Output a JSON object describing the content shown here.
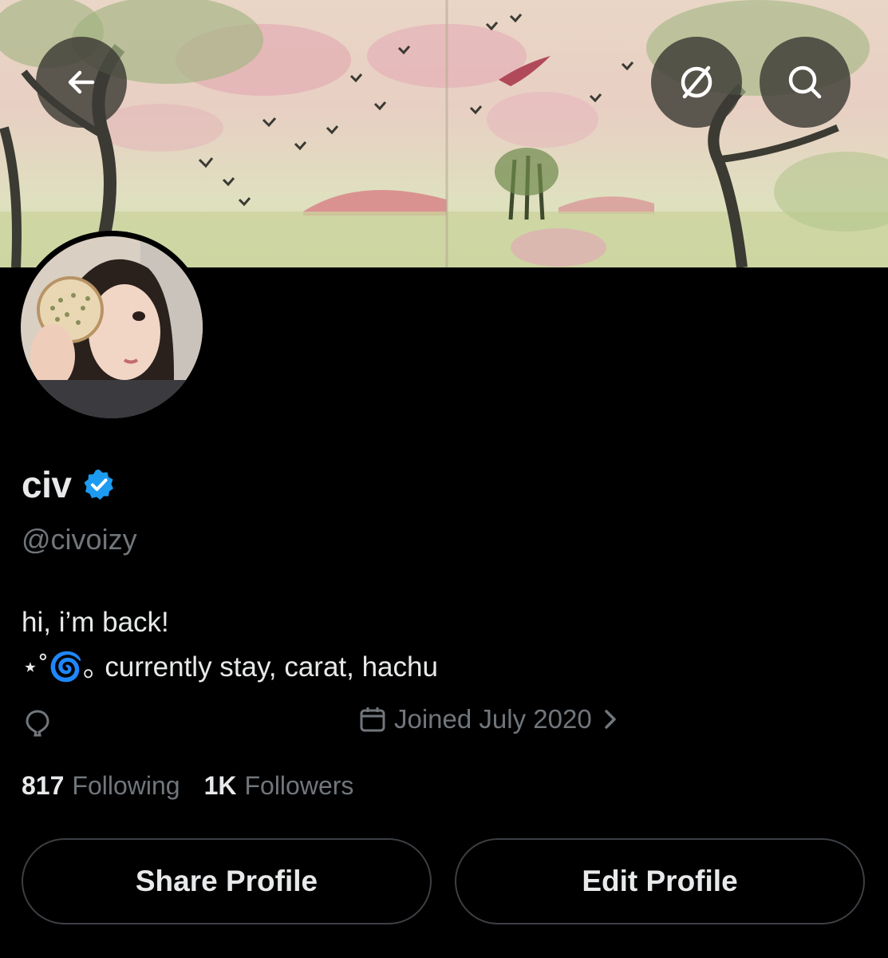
{
  "profile": {
    "display_name": "civ",
    "handle": "@civoizy",
    "verified": true,
    "bio_lines": [
      "hi, i’m back!",
      "⋆˚🌀｡ currently stay, carat, hachu"
    ],
    "joined": "Joined July 2020",
    "following_count": "817",
    "following_label": "Following",
    "followers_count": "1K",
    "followers_label": "Followers"
  },
  "buttons": {
    "share": "Share Profile",
    "edit": "Edit Profile"
  },
  "icons": {
    "back": "arrow-left-icon",
    "translate": "globe-slash-icon",
    "search": "search-icon",
    "location": "location-pin-icon",
    "calendar": "calendar-icon",
    "chevron": "chevron-right-icon",
    "verified": "verified-badge-icon"
  },
  "colors": {
    "background": "#000000",
    "text": "#e7e9ea",
    "muted": "#71767b",
    "verified": "#1d9bf0",
    "border": "#3c3f43"
  }
}
